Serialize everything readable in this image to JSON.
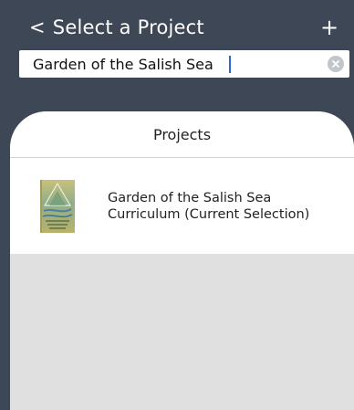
{
  "header": {
    "back_chevron": "<",
    "title": "Select a Project",
    "add_label": "+"
  },
  "search": {
    "value": "Garden of the Salish Sea",
    "placeholder": ""
  },
  "projects_section": {
    "title": "Projects",
    "items": [
      {
        "title_line1": "Garden of the Salish Sea",
        "title_line2": "Curriculum (Current Selection)",
        "thumbnail_icon": "book-cover-thumbnail"
      }
    ]
  },
  "colors": {
    "header_bg": "#3e4755",
    "sheet_bg": "#ffffff",
    "empty_area_bg": "#e0e0e0",
    "caret": "#2b66d9"
  }
}
